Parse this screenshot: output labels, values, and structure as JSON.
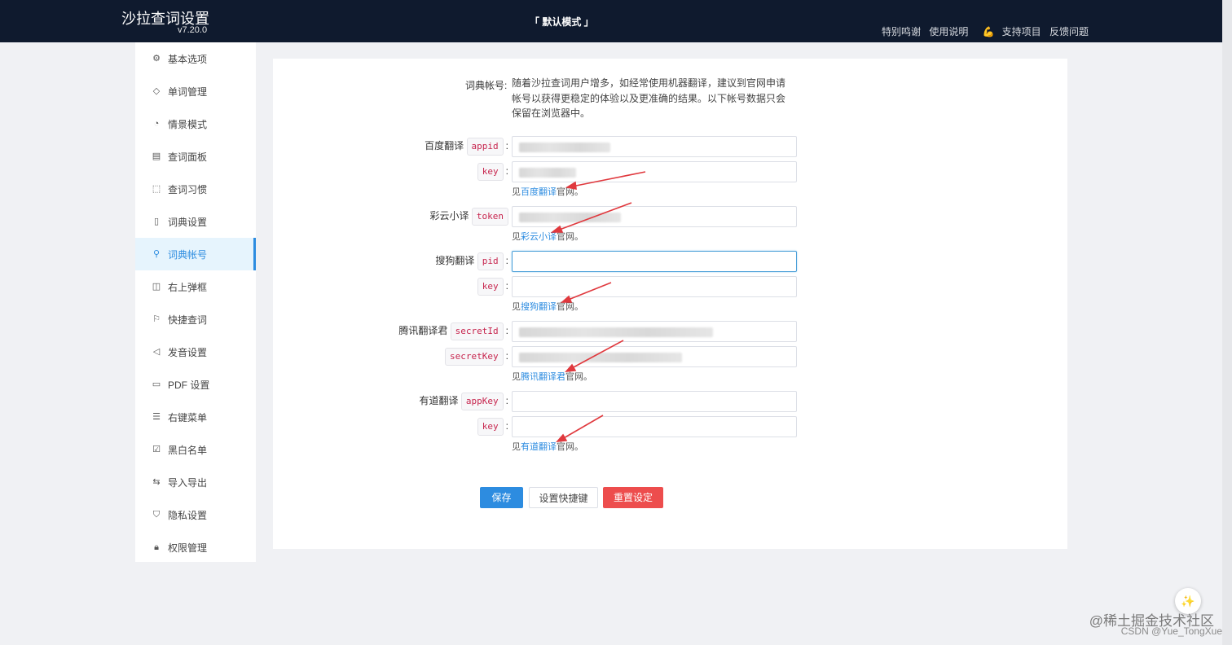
{
  "header": {
    "app_title": "沙拉查词设置",
    "version": "v7.20.0",
    "mode": "「 默认模式 」",
    "links": [
      "特别鸣谢",
      "使用说明",
      "支持项目",
      "反馈问题"
    ]
  },
  "sidebar": {
    "items": [
      {
        "label": "基本选项",
        "icon": "gear-icon"
      },
      {
        "label": "单词管理",
        "icon": "tag-icon"
      },
      {
        "label": "情景模式",
        "icon": "dashboard-icon"
      },
      {
        "label": "查词面板",
        "icon": "panel-icon"
      },
      {
        "label": "查词习惯",
        "icon": "cursor-select-icon"
      },
      {
        "label": "词典设置",
        "icon": "book-icon"
      },
      {
        "label": "词典帐号",
        "icon": "search-icon",
        "active": true
      },
      {
        "label": "右上弹框",
        "icon": "layout-icon"
      },
      {
        "label": "快捷查词",
        "icon": "flag-icon"
      },
      {
        "label": "发音设置",
        "icon": "speaker-icon"
      },
      {
        "label": "PDF 设置",
        "icon": "pdf-file-icon"
      },
      {
        "label": "右键菜单",
        "icon": "menu-list-icon"
      },
      {
        "label": "黑白名单",
        "icon": "list-check-icon"
      },
      {
        "label": "导入导出",
        "icon": "swap-icon"
      },
      {
        "label": "隐私设置",
        "icon": "shield-icon"
      },
      {
        "label": "权限管理",
        "icon": "lock-icon"
      }
    ]
  },
  "main": {
    "intro_label": "词典帐号:",
    "intro_text": "随着沙拉查词用户增多，如经常使用机器翻译，建议到官网申请帐号以获得更稳定的体验以及更准确的结果。以下帐号数据只会保留在浏览器中。",
    "baidu": {
      "label": "百度翻译",
      "tag1": "appid",
      "tag2": "key",
      "hint_prefix": "见",
      "hint_link": "百度翻译",
      "hint_suffix": "官网。"
    },
    "caiyun": {
      "label": "彩云小译",
      "tag1": "token",
      "hint_prefix": "见",
      "hint_link": "彩云小译",
      "hint_suffix": "官网。"
    },
    "sogou": {
      "label": "搜狗翻译",
      "tag1": "pid",
      "tag2": "key",
      "hint_prefix": "见",
      "hint_link": "搜狗翻译",
      "hint_suffix": "官网。"
    },
    "tencent": {
      "label": "腾讯翻译君",
      "tag1": "secretId",
      "tag2": "secretKey",
      "hint_prefix": "见",
      "hint_link": "腾讯翻译君",
      "hint_suffix": "官网。"
    },
    "youdao": {
      "label": "有道翻译",
      "tag1": "appKey",
      "tag2": "key",
      "hint_prefix": "见",
      "hint_link": "有道翻译",
      "hint_suffix": "官网。"
    },
    "colon": ":",
    "buttons": {
      "save": "保存",
      "shortcut": "设置快捷键",
      "reset": "重置设定"
    }
  },
  "watermark": {
    "line1": "@稀土掘金技术社区",
    "line2": "CSDN @Yue_TongXue"
  },
  "colors": {
    "header_bg": "#0f1a2e",
    "accent": "#2d8ce0",
    "danger": "#ed4d4d",
    "annotation_arrow": "#e0393e"
  }
}
